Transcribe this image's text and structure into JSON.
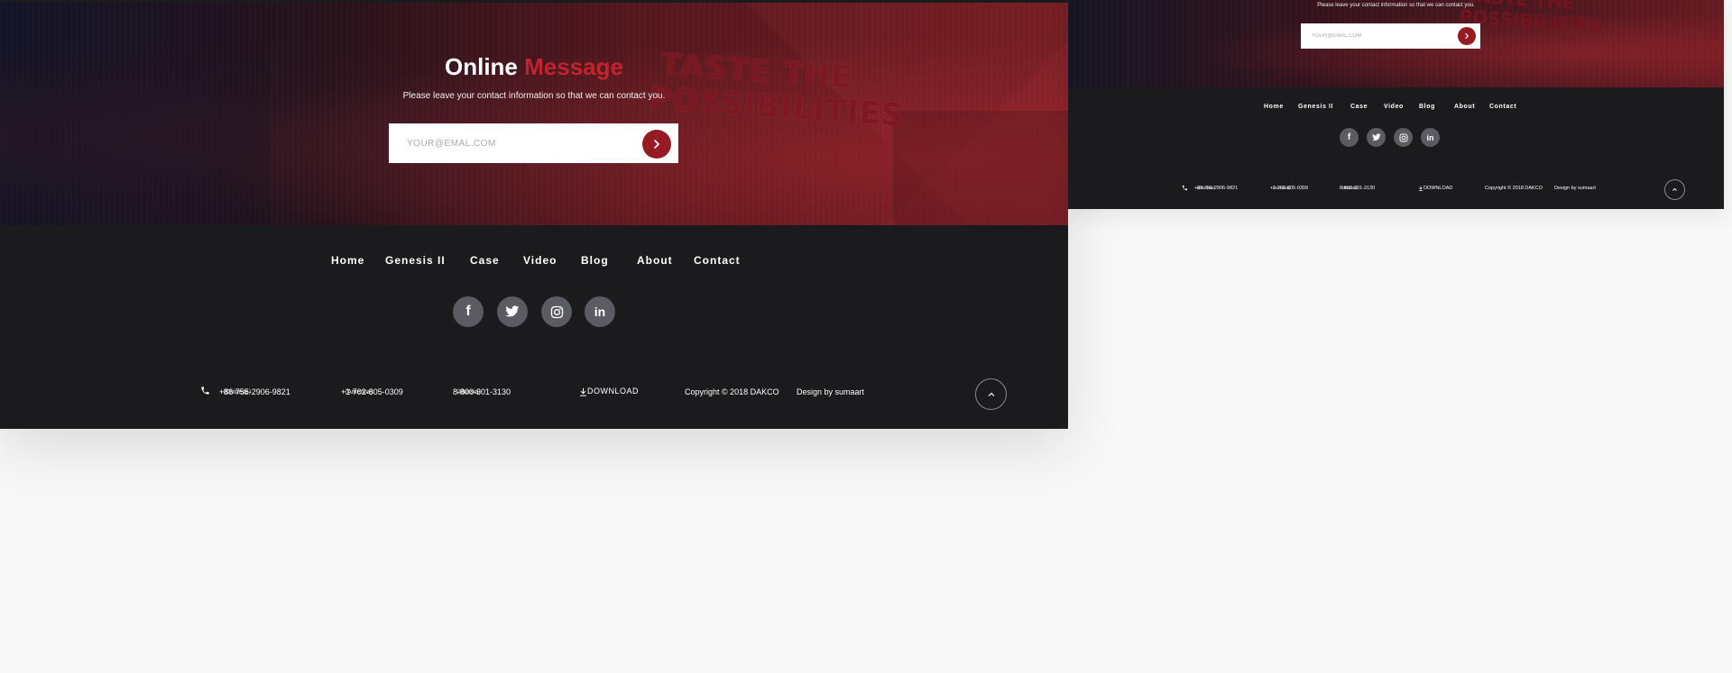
{
  "hero": {
    "title_main": "Online",
    "title_accent": "Message",
    "subtitle": "Please leave your contact information so that we can contact you.",
    "email_placeholder": "YOUR@EMAL.COM",
    "billboard_line1": "TASTE THE",
    "billboard_line2": "POSSIBILITIES"
  },
  "nav": {
    "items": [
      {
        "label": "Home"
      },
      {
        "label": "Genesis II"
      },
      {
        "label": "Case"
      },
      {
        "label": "Video"
      },
      {
        "label": "Blog"
      },
      {
        "label": "About"
      },
      {
        "label": "Contact"
      }
    ]
  },
  "social": {
    "items": [
      {
        "icon": "facebook-icon",
        "glyph": "f"
      },
      {
        "icon": "twitter-icon"
      },
      {
        "icon": "instagram-icon"
      },
      {
        "icon": "linkedin-icon",
        "glyph": "in"
      }
    ]
  },
  "contact": {
    "phone_cn": "+86 755-2906-9821",
    "phone_cn_region": "（Chinese）",
    "phone_us": "+1 702-805-0309",
    "phone_us_region": "（America）",
    "phone_ru": "8-800-301-3130",
    "phone_ru_region": "（Russia）",
    "download_label": "DOWNLOAD",
    "copyright": "Copyright © 2018 DAKCO",
    "design_by": "Design by sumaart"
  },
  "colors": {
    "accent": "#c1242e",
    "button": "#971b22",
    "footer_bg": "#1b1b1d",
    "social_bg": "#5a5b63",
    "page_bg": "#f8f8f8"
  }
}
